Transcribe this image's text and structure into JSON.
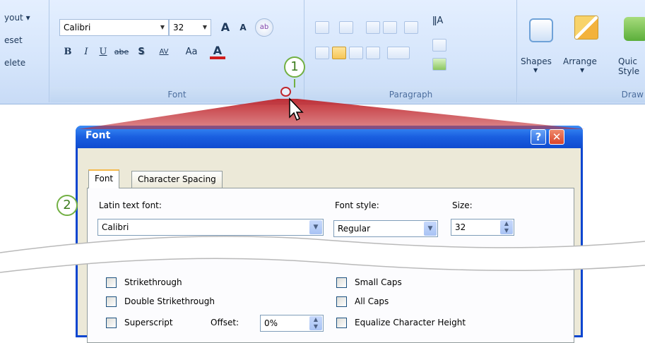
{
  "ribbon": {
    "slides_group": {
      "layout": "yout ▾",
      "reset": "eset",
      "delete": "elete"
    },
    "font_group": {
      "label": "Font",
      "font_name": "Calibri",
      "font_size": "32",
      "grow": "A",
      "shrink": "A",
      "bold": "B",
      "italic": "I",
      "underline": "U",
      "strike": "abe",
      "shadow": "S",
      "spacing": "AV",
      "case": "Aa",
      "color": "A"
    },
    "paragraph_group": {
      "label": "Paragraph"
    },
    "drawing_group": {
      "label": "Draw",
      "shapes": "Shapes",
      "arrange": "Arrange",
      "quick_line1": "Quic",
      "quick_line2": "Style"
    }
  },
  "callouts": {
    "one": "1",
    "two": "2"
  },
  "dialog": {
    "title": "Font",
    "help": "?",
    "close": "✕",
    "tabs": [
      "Font",
      "Character Spacing"
    ],
    "latin_font_label": "Latin text font:",
    "latin_font_value": "Calibri",
    "font_style_label": "Font style:",
    "font_style_value": "Regular",
    "size_label": "Size:",
    "size_value": "32",
    "effects": {
      "strikethrough": "Strikethrough",
      "double_strikethrough": "Double Strikethrough",
      "superscript": "Superscript",
      "offset_label": "Offset:",
      "offset_value": "0%",
      "small_caps": "Small Caps",
      "all_caps": "All Caps",
      "equalize": "Equalize Character Height"
    }
  },
  "colors": {
    "ribbon": "#d5e5fb",
    "dialog_title": "#1a5fe0",
    "callout_ring": "#72b043",
    "close_red": "#d9442b",
    "highlight_cone": "#c0272d"
  }
}
